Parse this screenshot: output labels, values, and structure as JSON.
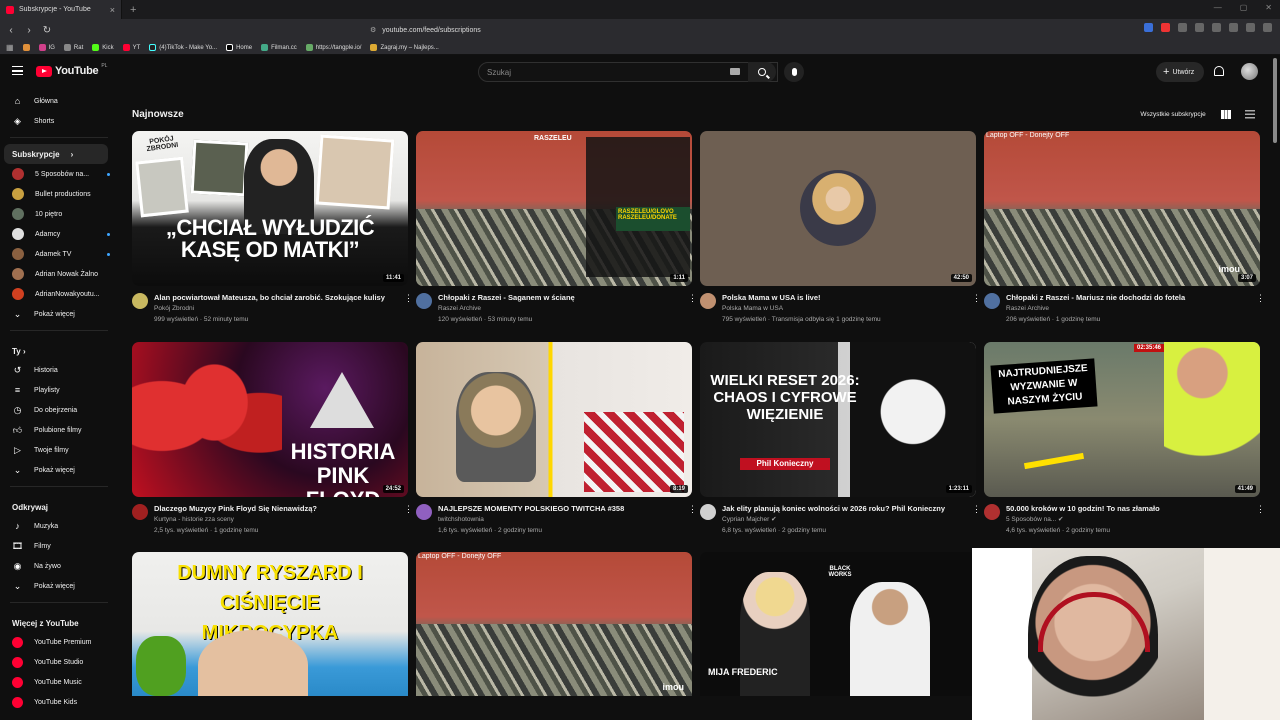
{
  "browser": {
    "tab_title": "Subskrypcje - YouTube",
    "url": "youtube.com/feed/subscriptions",
    "bookmarks": [
      "IG",
      "Rat",
      "Kick",
      "YT",
      "(4)TikTok - Make Yo...",
      "Home",
      "Filman.cc",
      "https://tangple.io/",
      "Zagraj.my – Najleps..."
    ]
  },
  "header": {
    "logo_text": "YouTube",
    "logo_region": "PL",
    "search_placeholder": "Szukaj",
    "create_label": "Utwórz"
  },
  "sidebar": {
    "primary": [
      {
        "label": "Główna",
        "icon": "home-icon"
      },
      {
        "label": "Shorts",
        "icon": "shorts-icon"
      }
    ],
    "subscriptions_heading": "Subskrypcje",
    "subscriptions": [
      {
        "label": "5 Sposobów na...",
        "color": "#b03030",
        "dot": true
      },
      {
        "label": "Bullet productions",
        "color": "#c8a040",
        "dot": false
      },
      {
        "label": "10 piętro",
        "color": "#607060",
        "dot": false
      },
      {
        "label": "Adamcy",
        "color": "#e0e0e0",
        "dot": true
      },
      {
        "label": "Adamek TV",
        "color": "#8a6040",
        "dot": true
      },
      {
        "label": "Adrian Nowak Żalno",
        "color": "#a07050",
        "dot": false
      },
      {
        "label": "AdrianNowakyoutu...",
        "color": "#d04020",
        "dot": true
      }
    ],
    "subs_more": "Pokaż więcej",
    "you_heading": "Ty",
    "you_items": [
      "Historia",
      "Playlisty",
      "Do obejrzenia",
      "Polubione filmy",
      "Twoje filmy",
      "Pokaż więcej"
    ],
    "explore_heading": "Odkrywaj",
    "explore_items": [
      "Muzyka",
      "Filmy",
      "Na żywo",
      "Pokaż więcej"
    ],
    "more_heading": "Więcej z YouTube",
    "more_items": [
      "YouTube Premium",
      "YouTube Studio",
      "YouTube Music",
      "YouTube Kids"
    ]
  },
  "feed": {
    "title": "Najnowsze",
    "all_subs_label": "Wszystkie subskrypcje",
    "videos": [
      {
        "title": "Alan pocwiartował Mateusza, bo chciał zarobić. Szokujące kulisy",
        "channel": "Pokój Zbrodni",
        "stats": "999 wyświetleń · 52 minuty temu",
        "duration": "11:41",
        "av": "#c8b860",
        "thumb_text": "„CHCIAŁ WYŁUDZIĆ KASĘ OD MATKI”",
        "thumb_sub": "POKÓJ ZBRODNI"
      },
      {
        "title": "Chłopaki z Raszei - Saganem w ścianę",
        "channel": "Raszei Archive",
        "stats": "120 wyświetleń · 53 minuty temu",
        "duration": "1:11",
        "av": "#5070a0",
        "thumb_text": "RASZELEU"
      },
      {
        "title": "Polska Mama w USA is live!",
        "channel": "Polska Mama w USA",
        "stats": "795 wyświetleń · Transmisja odbyła się 1 godzinę temu",
        "duration": "42:50",
        "av": "#c09070"
      },
      {
        "title": "Chłopaki z Raszei - Mariusz nie dochodzi do fotela",
        "channel": "Raszei Archive",
        "stats": "206 wyświetleń · 1 godzinę temu",
        "duration": "3:07",
        "av": "#5070a0",
        "thumb_text": "Laptop OFF - Donejty OFF",
        "thumb_logo": "imou"
      },
      {
        "title": "Dlaczego Muzycy Pink Floyd Się Nienawidzą?",
        "channel": "Kurtyna - historie zza sceny",
        "stats": "2,5 tys. wyświetleń · 1 godzinę temu",
        "duration": "24:52",
        "av": "#a02020",
        "thumb_text": "HISTORIA PINK FLOYD"
      },
      {
        "title": "NAJLEPSZE MOMENTY POLSKIEGO TWITCHA #358",
        "channel": "twitchshotownia",
        "stats": "1,6 tys. wyświetleń · 2 godziny temu",
        "duration": "8:19",
        "av": "#9060c0"
      },
      {
        "title": "Jak elity planują koniec wolności w 2026 roku? Phil Konieczny",
        "channel": "Cyprian Majcher",
        "stats": "6,8 tys. wyświetleń · 2 godziny temu",
        "duration": "1:23:11",
        "av": "#d0d0d0",
        "verified": true,
        "thumb_text": "WIELKI RESET 2026: CHAOS I CYFROWE WIĘZIENIE",
        "thumb_sub": "Phil Konieczny"
      },
      {
        "title": "50.000 kroków w 10 godzin! To nas złamało",
        "channel": "5 Sposobów na...",
        "stats": "4,6 tys. wyświetleń · 2 godziny temu",
        "duration": "41:49",
        "av": "#b03030",
        "verified": true,
        "thumb_text": "NAJTRUDNIEJSZE WYZWANIE W NASZYM ŻYCIU",
        "thumb_timer": "02:35:46"
      },
      {
        "title": "",
        "thumb_text": "DUMNY RYSZARD I CIŚNIĘCIE MIKROCYPKA"
      },
      {
        "title": "",
        "thumb_text": "Laptop OFF - Donejty OFF",
        "thumb_logo": "imou"
      },
      {
        "title": "",
        "thumb_text": "MIJA FREDERIC",
        "thumb_sub": "BLACK WORKS"
      }
    ]
  },
  "colors": {
    "accent": "#ff0033",
    "bg": "#0f0f0f",
    "text_secondary": "#aaaaaa",
    "link_blue": "#3ea6ff"
  }
}
